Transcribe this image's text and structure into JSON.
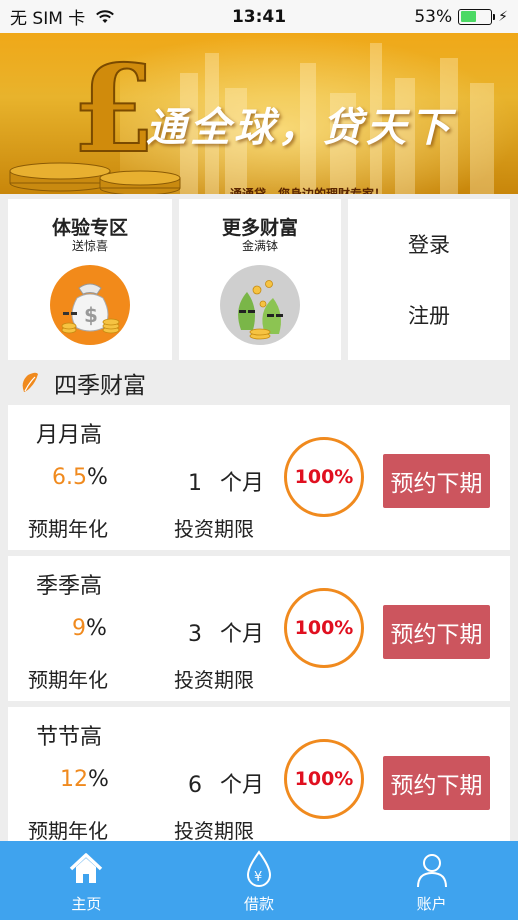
{
  "status_bar": {
    "carrier": "无 SIM 卡",
    "time": "13:41",
    "battery": "53%",
    "battery_level": 0.53
  },
  "banner": {
    "slogan": "通全球，贷天下",
    "subtitle": "通通贷，您身边的理财专家！",
    "page_count": 3,
    "active_page": 1
  },
  "promos": [
    {
      "title": "体验专区",
      "subtitle": "送惊喜",
      "icon": "money-bag-icon"
    },
    {
      "title": "更多财富",
      "subtitle": "金满钵",
      "icon": "plant-coins-icon"
    }
  ],
  "auth": {
    "login": "登录",
    "register": "注册"
  },
  "section": {
    "title": "四季财富",
    "icon": "leaf-icon"
  },
  "labels": {
    "rate": "预期年化",
    "period": "投资期限",
    "unit_month": "个月",
    "percent_sign": "%"
  },
  "products": [
    {
      "name": "月月高",
      "rate": "6.5",
      "months": "1",
      "progress": "100%",
      "button": "预约下期"
    },
    {
      "name": "季季高",
      "rate": "9",
      "months": "3",
      "progress": "100%",
      "button": "预约下期"
    },
    {
      "name": "节节高",
      "rate": "12",
      "months": "6",
      "progress": "100%",
      "button": "预约下期"
    }
  ],
  "tabs": [
    {
      "label": "主页",
      "icon": "home-icon"
    },
    {
      "label": "借款",
      "icon": "drop-yen-icon"
    },
    {
      "label": "账户",
      "icon": "user-icon"
    }
  ],
  "colors": {
    "accent_orange": "#f08a1e",
    "progress_red": "#e01020",
    "button_red": "#cc555e",
    "tab_blue": "#3fa3ee"
  }
}
